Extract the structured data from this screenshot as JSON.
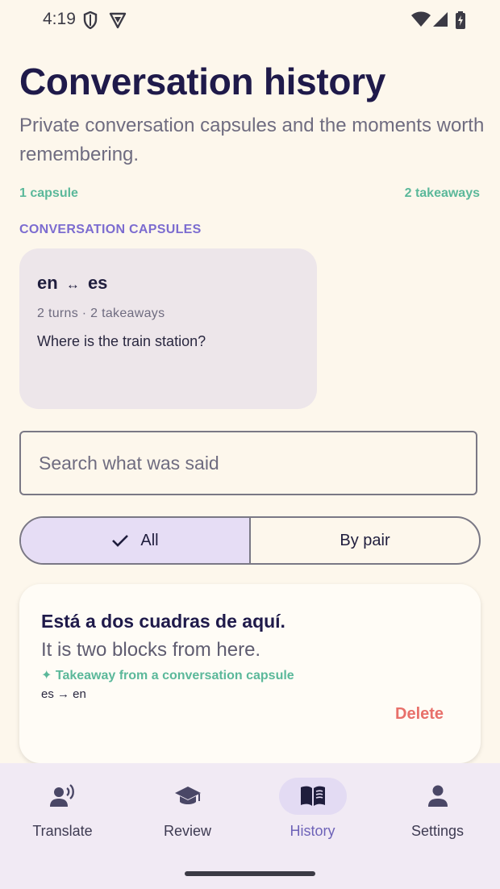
{
  "status_bar": {
    "time": "4:19"
  },
  "header": {
    "title": "Conversation history",
    "subtitle": "Private conversation capsules and the moments worth remembering."
  },
  "stats": {
    "capsules": "1 capsule",
    "takeaways": "2 takeaways"
  },
  "capsules_section": {
    "label": "CONVERSATION CAPSULES",
    "items": [
      {
        "pair_from": "en",
        "pair_arrow": "↔",
        "pair_to": "es",
        "meta": "2 turns · 2 takeaways",
        "preview": "Where is the train station?"
      }
    ]
  },
  "search": {
    "placeholder": "Search what was said",
    "value": ""
  },
  "filter": {
    "options": [
      {
        "label": "All",
        "selected": true
      },
      {
        "label": "By pair",
        "selected": false
      }
    ]
  },
  "takeaways": [
    {
      "original": "Está a dos cuadras de aquí.",
      "translation": "It is two blocks from here.",
      "source_icon": "✦",
      "source": "Takeaway from a conversation capsule",
      "direction": "es → en",
      "delete_label": "Delete"
    }
  ],
  "nav": {
    "items": [
      {
        "label": "Translate",
        "icon": "speaking-person-icon",
        "active": false
      },
      {
        "label": "Review",
        "icon": "graduation-cap-icon",
        "active": false
      },
      {
        "label": "History",
        "icon": "open-book-icon",
        "active": true
      },
      {
        "label": "Settings",
        "icon": "person-icon",
        "active": false
      }
    ]
  },
  "colors": {
    "background": "#fdf7ec",
    "accent_green": "#5bb89a",
    "accent_purple": "#7c6cd0",
    "delete_red": "#e8706a",
    "nav_active": "#6e63b8"
  }
}
